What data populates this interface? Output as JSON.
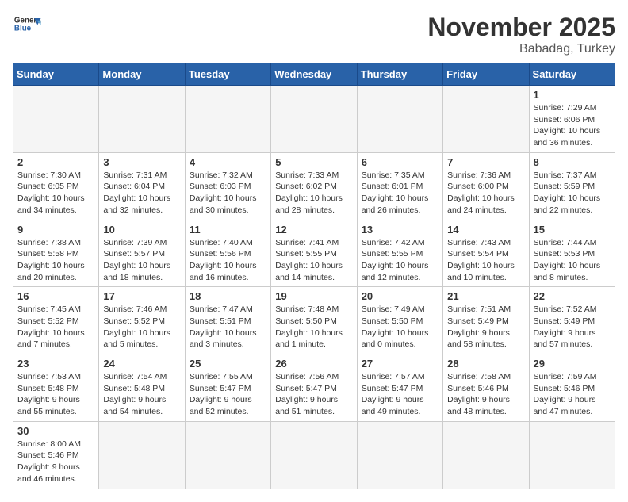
{
  "header": {
    "logo_general": "General",
    "logo_blue": "Blue",
    "month_year": "November 2025",
    "location": "Babadag, Turkey"
  },
  "weekdays": [
    "Sunday",
    "Monday",
    "Tuesday",
    "Wednesday",
    "Thursday",
    "Friday",
    "Saturday"
  ],
  "weeks": [
    [
      {
        "day": "",
        "sunrise": "",
        "sunset": "",
        "daylight": "",
        "empty": true
      },
      {
        "day": "",
        "sunrise": "",
        "sunset": "",
        "daylight": "",
        "empty": true
      },
      {
        "day": "",
        "sunrise": "",
        "sunset": "",
        "daylight": "",
        "empty": true
      },
      {
        "day": "",
        "sunrise": "",
        "sunset": "",
        "daylight": "",
        "empty": true
      },
      {
        "day": "",
        "sunrise": "",
        "sunset": "",
        "daylight": "",
        "empty": true
      },
      {
        "day": "",
        "sunrise": "",
        "sunset": "",
        "daylight": "",
        "empty": true
      },
      {
        "day": "1",
        "sunrise": "Sunrise: 7:29 AM",
        "sunset": "Sunset: 6:06 PM",
        "daylight": "Daylight: 10 hours and 36 minutes.",
        "empty": false
      }
    ],
    [
      {
        "day": "2",
        "sunrise": "Sunrise: 7:30 AM",
        "sunset": "Sunset: 6:05 PM",
        "daylight": "Daylight: 10 hours and 34 minutes.",
        "empty": false
      },
      {
        "day": "3",
        "sunrise": "Sunrise: 7:31 AM",
        "sunset": "Sunset: 6:04 PM",
        "daylight": "Daylight: 10 hours and 32 minutes.",
        "empty": false
      },
      {
        "day": "4",
        "sunrise": "Sunrise: 7:32 AM",
        "sunset": "Sunset: 6:03 PM",
        "daylight": "Daylight: 10 hours and 30 minutes.",
        "empty": false
      },
      {
        "day": "5",
        "sunrise": "Sunrise: 7:33 AM",
        "sunset": "Sunset: 6:02 PM",
        "daylight": "Daylight: 10 hours and 28 minutes.",
        "empty": false
      },
      {
        "day": "6",
        "sunrise": "Sunrise: 7:35 AM",
        "sunset": "Sunset: 6:01 PM",
        "daylight": "Daylight: 10 hours and 26 minutes.",
        "empty": false
      },
      {
        "day": "7",
        "sunrise": "Sunrise: 7:36 AM",
        "sunset": "Sunset: 6:00 PM",
        "daylight": "Daylight: 10 hours and 24 minutes.",
        "empty": false
      },
      {
        "day": "8",
        "sunrise": "Sunrise: 7:37 AM",
        "sunset": "Sunset: 5:59 PM",
        "daylight": "Daylight: 10 hours and 22 minutes.",
        "empty": false
      }
    ],
    [
      {
        "day": "9",
        "sunrise": "Sunrise: 7:38 AM",
        "sunset": "Sunset: 5:58 PM",
        "daylight": "Daylight: 10 hours and 20 minutes.",
        "empty": false
      },
      {
        "day": "10",
        "sunrise": "Sunrise: 7:39 AM",
        "sunset": "Sunset: 5:57 PM",
        "daylight": "Daylight: 10 hours and 18 minutes.",
        "empty": false
      },
      {
        "day": "11",
        "sunrise": "Sunrise: 7:40 AM",
        "sunset": "Sunset: 5:56 PM",
        "daylight": "Daylight: 10 hours and 16 minutes.",
        "empty": false
      },
      {
        "day": "12",
        "sunrise": "Sunrise: 7:41 AM",
        "sunset": "Sunset: 5:55 PM",
        "daylight": "Daylight: 10 hours and 14 minutes.",
        "empty": false
      },
      {
        "day": "13",
        "sunrise": "Sunrise: 7:42 AM",
        "sunset": "Sunset: 5:55 PM",
        "daylight": "Daylight: 10 hours and 12 minutes.",
        "empty": false
      },
      {
        "day": "14",
        "sunrise": "Sunrise: 7:43 AM",
        "sunset": "Sunset: 5:54 PM",
        "daylight": "Daylight: 10 hours and 10 minutes.",
        "empty": false
      },
      {
        "day": "15",
        "sunrise": "Sunrise: 7:44 AM",
        "sunset": "Sunset: 5:53 PM",
        "daylight": "Daylight: 10 hours and 8 minutes.",
        "empty": false
      }
    ],
    [
      {
        "day": "16",
        "sunrise": "Sunrise: 7:45 AM",
        "sunset": "Sunset: 5:52 PM",
        "daylight": "Daylight: 10 hours and 7 minutes.",
        "empty": false
      },
      {
        "day": "17",
        "sunrise": "Sunrise: 7:46 AM",
        "sunset": "Sunset: 5:52 PM",
        "daylight": "Daylight: 10 hours and 5 minutes.",
        "empty": false
      },
      {
        "day": "18",
        "sunrise": "Sunrise: 7:47 AM",
        "sunset": "Sunset: 5:51 PM",
        "daylight": "Daylight: 10 hours and 3 minutes.",
        "empty": false
      },
      {
        "day": "19",
        "sunrise": "Sunrise: 7:48 AM",
        "sunset": "Sunset: 5:50 PM",
        "daylight": "Daylight: 10 hours and 1 minute.",
        "empty": false
      },
      {
        "day": "20",
        "sunrise": "Sunrise: 7:49 AM",
        "sunset": "Sunset: 5:50 PM",
        "daylight": "Daylight: 10 hours and 0 minutes.",
        "empty": false
      },
      {
        "day": "21",
        "sunrise": "Sunrise: 7:51 AM",
        "sunset": "Sunset: 5:49 PM",
        "daylight": "Daylight: 9 hours and 58 minutes.",
        "empty": false
      },
      {
        "day": "22",
        "sunrise": "Sunrise: 7:52 AM",
        "sunset": "Sunset: 5:49 PM",
        "daylight": "Daylight: 9 hours and 57 minutes.",
        "empty": false
      }
    ],
    [
      {
        "day": "23",
        "sunrise": "Sunrise: 7:53 AM",
        "sunset": "Sunset: 5:48 PM",
        "daylight": "Daylight: 9 hours and 55 minutes.",
        "empty": false
      },
      {
        "day": "24",
        "sunrise": "Sunrise: 7:54 AM",
        "sunset": "Sunset: 5:48 PM",
        "daylight": "Daylight: 9 hours and 54 minutes.",
        "empty": false
      },
      {
        "day": "25",
        "sunrise": "Sunrise: 7:55 AM",
        "sunset": "Sunset: 5:47 PM",
        "daylight": "Daylight: 9 hours and 52 minutes.",
        "empty": false
      },
      {
        "day": "26",
        "sunrise": "Sunrise: 7:56 AM",
        "sunset": "Sunset: 5:47 PM",
        "daylight": "Daylight: 9 hours and 51 minutes.",
        "empty": false
      },
      {
        "day": "27",
        "sunrise": "Sunrise: 7:57 AM",
        "sunset": "Sunset: 5:47 PM",
        "daylight": "Daylight: 9 hours and 49 minutes.",
        "empty": false
      },
      {
        "day": "28",
        "sunrise": "Sunrise: 7:58 AM",
        "sunset": "Sunset: 5:46 PM",
        "daylight": "Daylight: 9 hours and 48 minutes.",
        "empty": false
      },
      {
        "day": "29",
        "sunrise": "Sunrise: 7:59 AM",
        "sunset": "Sunset: 5:46 PM",
        "daylight": "Daylight: 9 hours and 47 minutes.",
        "empty": false
      }
    ],
    [
      {
        "day": "30",
        "sunrise": "Sunrise: 8:00 AM",
        "sunset": "Sunset: 5:46 PM",
        "daylight": "Daylight: 9 hours and 46 minutes.",
        "empty": false
      },
      {
        "day": "",
        "sunrise": "",
        "sunset": "",
        "daylight": "",
        "empty": true
      },
      {
        "day": "",
        "sunrise": "",
        "sunset": "",
        "daylight": "",
        "empty": true
      },
      {
        "day": "",
        "sunrise": "",
        "sunset": "",
        "daylight": "",
        "empty": true
      },
      {
        "day": "",
        "sunrise": "",
        "sunset": "",
        "daylight": "",
        "empty": true
      },
      {
        "day": "",
        "sunrise": "",
        "sunset": "",
        "daylight": "",
        "empty": true
      },
      {
        "day": "",
        "sunrise": "",
        "sunset": "",
        "daylight": "",
        "empty": true
      }
    ]
  ]
}
